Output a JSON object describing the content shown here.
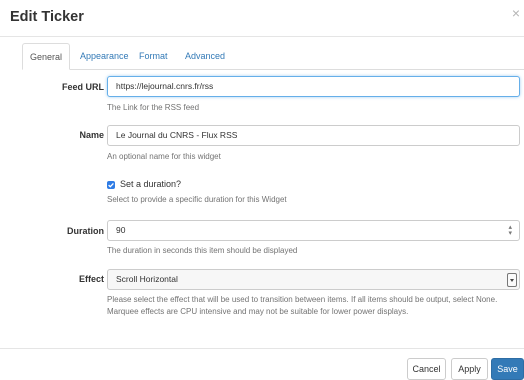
{
  "dialog": {
    "title": "Edit Ticker",
    "close": "×"
  },
  "tabs": [
    {
      "label": "General",
      "active": true
    },
    {
      "label": "Appearance",
      "active": false
    },
    {
      "label": "Format",
      "active": false
    },
    {
      "label": "Advanced",
      "active": false
    }
  ],
  "fields": {
    "feed_url": {
      "label": "Feed URL",
      "value": "https://lejournal.cnrs.fr/rss",
      "help": "The Link for the RSS feed"
    },
    "name": {
      "label": "Name",
      "value": "Le Journal du CNRS - Flux RSS",
      "help": "An optional name for this widget"
    },
    "set_duration": {
      "label": "Set a duration?",
      "checked": true,
      "help": "Select to provide a specific duration for this Widget"
    },
    "duration": {
      "label": "Duration",
      "value": "90",
      "help": "The duration in seconds this item should be displayed"
    },
    "effect": {
      "label": "Effect",
      "value": "Scroll Horizontal",
      "help_line1": "Please select the effect that will be used to transition between items. If all items should be output, select None.",
      "help_line2": "Marquee effects are CPU intensive and may not be suitable for lower power displays."
    }
  },
  "buttons": {
    "cancel": "Cancel",
    "apply": "Apply",
    "save": "Save"
  },
  "colors": {
    "accent": "#337ab7",
    "checkbox": "#2f7ce5",
    "focus_border": "#66afe9"
  }
}
